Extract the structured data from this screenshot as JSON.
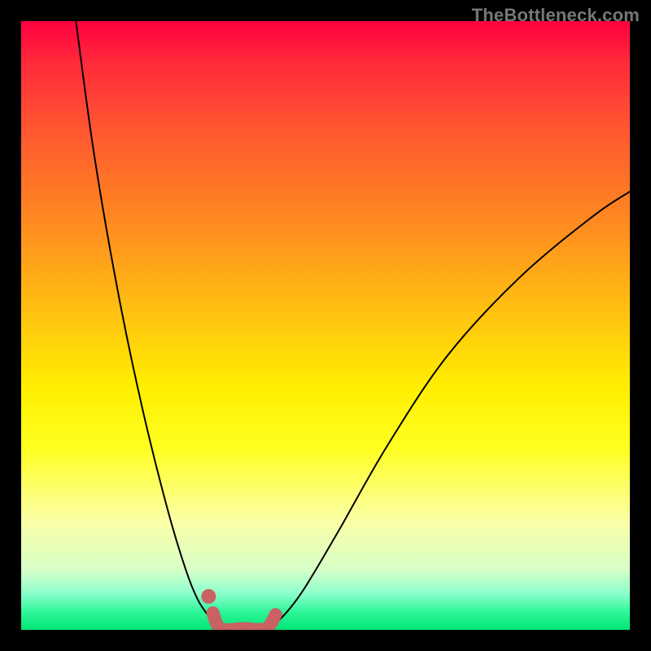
{
  "watermark": "TheBottleneck.com",
  "colors": {
    "curve": "#000000",
    "highlight": "#c96262",
    "background_top": "#ff0040",
    "background_bottom": "#00e676"
  },
  "chart_data": {
    "type": "line",
    "title": "",
    "xlabel": "",
    "ylabel": "",
    "xlim": [
      0,
      100
    ],
    "ylim": [
      0,
      100
    ],
    "series": [
      {
        "name": "left-branch",
        "x": [
          9,
          12,
          16,
          20,
          24,
          27,
          29,
          31,
          32.2,
          32.8
        ],
        "values": [
          100,
          78,
          55,
          36,
          20,
          10,
          5,
          2,
          0.8,
          0.2
        ]
      },
      {
        "name": "floor",
        "x": [
          32.8,
          40.2
        ],
        "values": [
          0.2,
          0.2
        ]
      },
      {
        "name": "right-branch",
        "x": [
          40.2,
          42,
          46,
          52,
          60,
          70,
          82,
          94,
          100
        ],
        "values": [
          0.2,
          1.2,
          6,
          16,
          30,
          45,
          58,
          68,
          72
        ]
      }
    ],
    "highlight_segment": {
      "name": "good-zone",
      "x": [
        31.5,
        32.8,
        36.5,
        40.2,
        41.8
      ],
      "values": [
        2.8,
        0.2,
        0.2,
        0.2,
        2.5
      ]
    },
    "highlight_point": {
      "x": 30.8,
      "y": 5.5
    },
    "annotations": []
  }
}
